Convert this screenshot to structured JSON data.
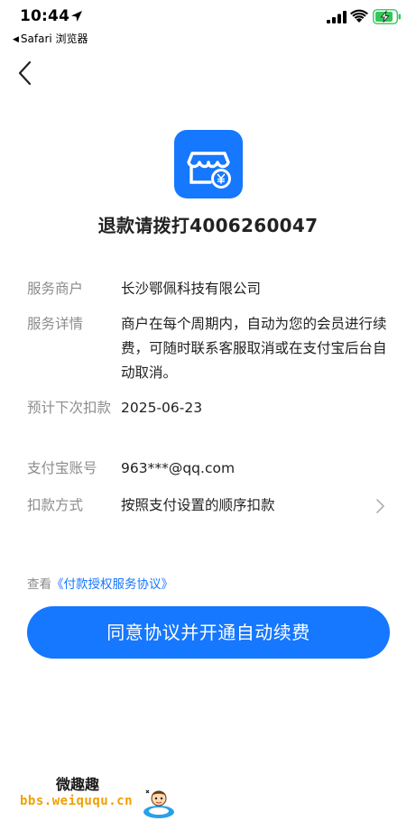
{
  "status_bar": {
    "time": "10:44",
    "back_app": "Safari 浏览器"
  },
  "header": {
    "refund_phone_text": "退款请拨打4006260047"
  },
  "details": [
    {
      "label": "服务商户",
      "value": "长沙鄂佩科技有限公司"
    },
    {
      "label": "服务详情",
      "value": "商户在每个周期内，自动为您的会员进行续费，可随时联系客服取消或在支付宝后台自动取消。"
    },
    {
      "label": "预计下次扣款",
      "value": "2025-06-23"
    },
    {
      "label": "支付宝账号",
      "value": "963***@qq.com"
    },
    {
      "label": "扣款方式",
      "value": "按照支付设置的顺序扣款"
    }
  ],
  "agreement": {
    "prefix": "查看",
    "link": "《付款授权服务协议》"
  },
  "confirm_button": "同意协议并开通自动续费",
  "watermark": {
    "title": "微趣趣",
    "url": "bbs.weiququ.cn"
  },
  "colors": {
    "accent": "#1677ff",
    "label": "#8c8c8c",
    "battery": "#34c759"
  }
}
